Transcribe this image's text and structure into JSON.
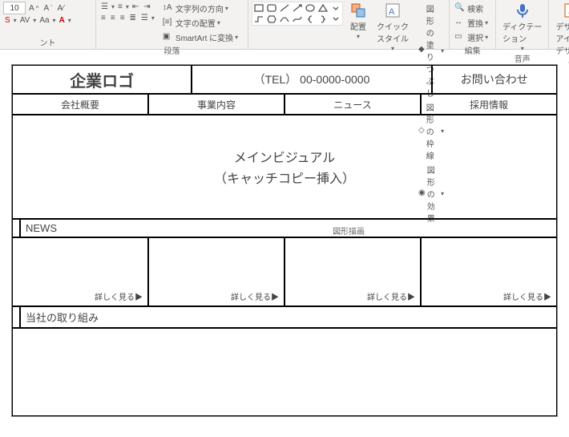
{
  "ribbon": {
    "font": {
      "size": "10"
    },
    "para": {
      "text_direction": "文字列の方向",
      "text_align": "文字の配置",
      "smartart": "SmartArt に変換",
      "group_label": "段落"
    },
    "shapes": {
      "arrange": "配置",
      "quick_styles": "クイック\nスタイル",
      "fill": "図形の塗りつぶし",
      "outline": "図形の枠線",
      "effects": "図形の効果",
      "group_label": "図形描画"
    },
    "editing": {
      "find": "検索",
      "replace": "置換",
      "select": "選択",
      "group_label": "編集"
    },
    "voice": {
      "dictate": "ディクテー\nション",
      "group_label": "音声"
    },
    "design": {
      "ideas": "デザイン\nアイデア",
      "group_label": "デザイナー"
    }
  },
  "page": {
    "logo": "企業ロゴ",
    "tel": "（TEL） 00-0000-0000",
    "contact": "お問い合わせ",
    "nav": [
      "会社概要",
      "事業内容",
      "ニュース",
      "採用情報"
    ],
    "visual_line1": "メインビジュアル",
    "visual_line2": "（キャッチコピー挿入）",
    "news_title": "NEWS",
    "more": "詳しく見る▶",
    "efforts_title": "当社の取り組み"
  }
}
